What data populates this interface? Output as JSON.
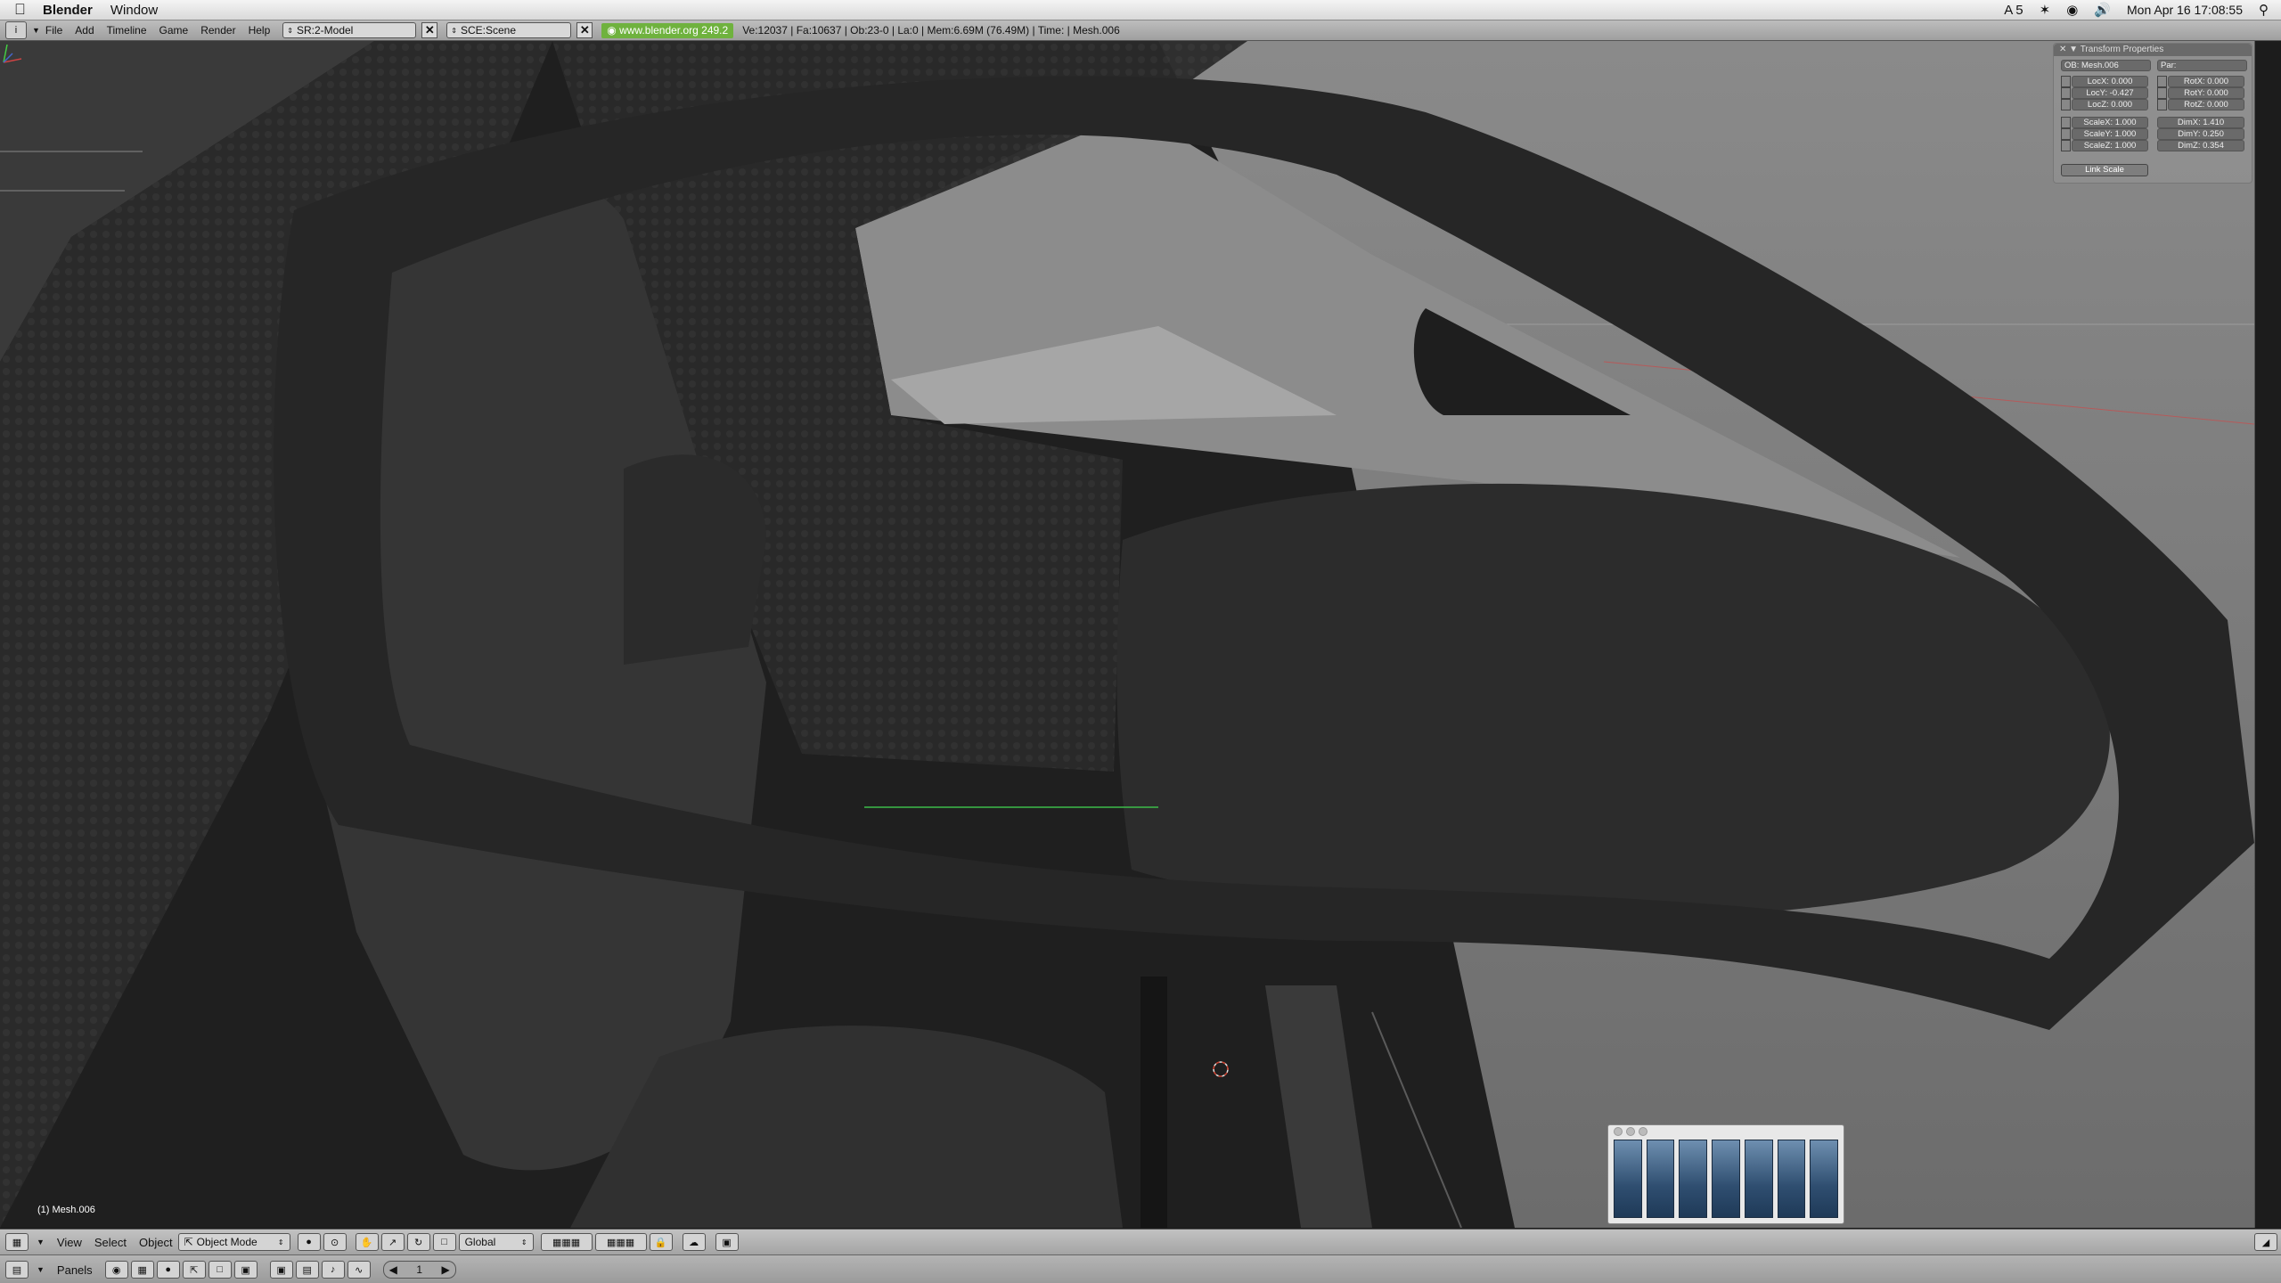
{
  "macbar": {
    "app": "Blender",
    "menu": [
      "Window"
    ],
    "status_badge": "5",
    "datetime": "Mon Apr 16  17:08:55"
  },
  "header": {
    "menus": [
      "File",
      "Add",
      "Timeline",
      "Game",
      "Render",
      "Help"
    ],
    "screen": "SR:2-Model",
    "scene": "SCE:Scene",
    "url": "www.blender.org 249.2",
    "stats": "Ve:12037 | Fa:10637 | Ob:23-0 | La:0  | Mem:6.69M (76.49M)  | Time: | Mesh.006"
  },
  "viewport": {
    "object_label": "(1) Mesh.006"
  },
  "transform": {
    "title": "Transform Properties",
    "ob": "OB: Mesh.006",
    "par": "Par:",
    "loc": [
      "LocX: 0.000",
      "LocY: -0.427",
      "LocZ: 0.000"
    ],
    "rot": [
      "RotX: 0.000",
      "RotY: 0.000",
      "RotZ: 0.000"
    ],
    "scale": [
      "ScaleX: 1.000",
      "ScaleY: 1.000",
      "ScaleZ: 1.000"
    ],
    "dim": [
      "DimX: 1.410",
      "DimY: 0.250",
      "DimZ: 0.354"
    ],
    "link_scale": "Link Scale"
  },
  "footer": {
    "menus": [
      "View",
      "Select",
      "Object"
    ],
    "mode": "Object Mode",
    "orientation": "Global",
    "panels": "Panels",
    "frame": "1"
  },
  "colors": {
    "url_bg": "#6fb23e",
    "header_bg": "#b0b0b0"
  }
}
